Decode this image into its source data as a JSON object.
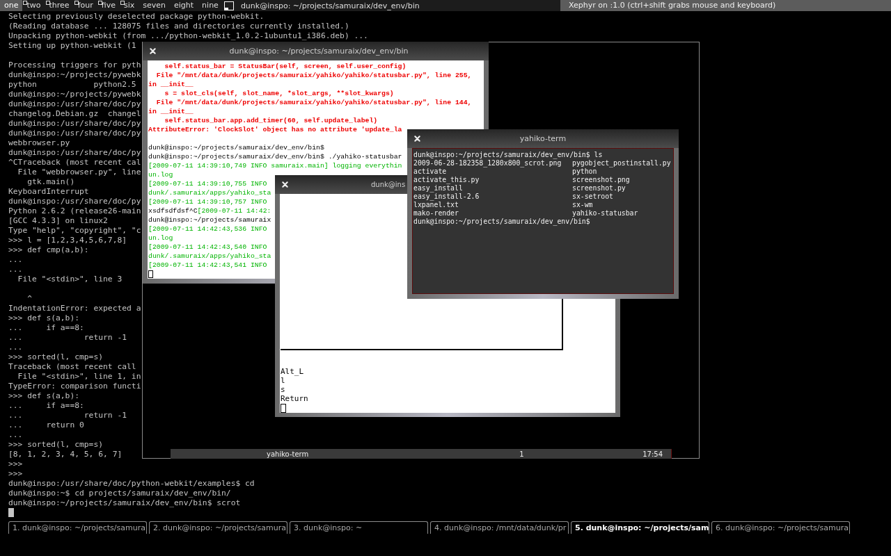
{
  "top_bar": {
    "workspaces": [
      {
        "label": "one",
        "selected": true,
        "occupied": false
      },
      {
        "label": "two",
        "selected": false,
        "occupied": true
      },
      {
        "label": "three",
        "selected": false,
        "occupied": true
      },
      {
        "label": "four",
        "selected": false,
        "occupied": true
      },
      {
        "label": "five",
        "selected": false,
        "occupied": true
      },
      {
        "label": "six",
        "selected": false,
        "occupied": true
      },
      {
        "label": "seven",
        "selected": false,
        "occupied": false
      },
      {
        "label": "eight",
        "selected": false,
        "occupied": false
      },
      {
        "label": "nine",
        "selected": false,
        "occupied": false
      }
    ],
    "window_title": "dunk@inspo: ~/projects/samuraix/dev_env/bin",
    "xephyr_title": "Xephyr on :1.0 (ctrl+shift grabs mouse and keyboard)"
  },
  "main_terminal": {
    "lines": [
      {
        "kind": "text",
        "text": "Selecting previously deselected package python-webkit."
      },
      {
        "kind": "text",
        "text": "(Reading database ... 128075 files and directories currently installed.)"
      },
      {
        "kind": "text",
        "text": "Unpacking python-webkit (from .../python-webkit_1.0.2-1ubuntu1_i386.deb) ..."
      },
      {
        "kind": "text",
        "text": "Setting up python-webkit (1"
      },
      {
        "kind": "blank"
      },
      {
        "kind": "text",
        "text": "Processing triggers for pyth"
      },
      {
        "kind": "text",
        "text": "dunk@inspo:~/projects/pywebk"
      },
      {
        "kind": "text",
        "text": "python            python2.5"
      },
      {
        "kind": "text",
        "text": "dunk@inspo:~/projects/pywebk"
      },
      {
        "kind": "text",
        "text": "dunk@inspo:/usr/share/doc/py"
      },
      {
        "kind": "text",
        "text": "changelog.Debian.gz  changel"
      },
      {
        "kind": "text",
        "text": "dunk@inspo:/usr/share/doc/py"
      },
      {
        "kind": "text",
        "text": "dunk@inspo:/usr/share/doc/py"
      },
      {
        "kind": "text",
        "text": "webbrowser.py"
      },
      {
        "kind": "text",
        "text": "dunk@inspo:/usr/share/doc/py"
      },
      {
        "kind": "text",
        "text": "^CTraceback (most recent cal"
      },
      {
        "kind": "text",
        "text": "  File \"webbrowser.py\", line"
      },
      {
        "kind": "text",
        "text": "    gtk.main()"
      },
      {
        "kind": "text",
        "text": "KeyboardInterrupt"
      },
      {
        "kind": "text",
        "text": "dunk@inspo:/usr/share/doc/py"
      },
      {
        "kind": "text",
        "text": "Python 2.6.2 (release26-main"
      },
      {
        "kind": "text",
        "text": "[GCC 4.3.3] on linux2"
      },
      {
        "kind": "text",
        "text": "Type \"help\", \"copyright\", \"c"
      },
      {
        "kind": "text",
        "text": ">>> l = [1,2,3,4,5,6,7,8]"
      },
      {
        "kind": "text",
        "text": ">>> def cmp(a,b):"
      },
      {
        "kind": "text",
        "text": "..."
      },
      {
        "kind": "text",
        "text": "..."
      },
      {
        "kind": "text",
        "text": "  File \"<stdin>\", line 3"
      },
      {
        "kind": "blank"
      },
      {
        "kind": "text",
        "text": "    ^"
      },
      {
        "kind": "text",
        "text": "IndentationError: expected a"
      },
      {
        "kind": "text",
        "text": ">>> def s(a,b):"
      },
      {
        "kind": "text",
        "text": "...     if a==8:"
      },
      {
        "kind": "text",
        "text": "...             return -1"
      },
      {
        "kind": "text",
        "text": "..."
      },
      {
        "kind": "text",
        "text": ">>> sorted(l, cmp=s)"
      },
      {
        "kind": "text",
        "text": "Traceback (most recent call"
      },
      {
        "kind": "text",
        "text": "  File \"<stdin>\", line 1, in"
      },
      {
        "kind": "text",
        "text": "TypeError: comparison functi"
      },
      {
        "kind": "text",
        "text": ">>> def s(a,b):"
      },
      {
        "kind": "text",
        "text": "...     if a==8:"
      },
      {
        "kind": "text",
        "text": "...             return -1"
      },
      {
        "kind": "text",
        "text": "...     return 0"
      },
      {
        "kind": "text",
        "text": "..."
      },
      {
        "kind": "text",
        "text": ">>> sorted(l, cmp=s)"
      },
      {
        "kind": "text",
        "text": "[8, 1, 2, 3, 4, 5, 6, 7]"
      },
      {
        "kind": "text",
        "text": ">>>"
      },
      {
        "kind": "text",
        "text": ">>>"
      },
      {
        "kind": "text",
        "text": "dunk@inspo:/usr/share/doc/python-webkit/examples$ cd"
      },
      {
        "kind": "text",
        "text": "dunk@inspo:~$ cd projects/samuraix/dev_env/bin/"
      },
      {
        "kind": "text",
        "text": "dunk@inspo:~/projects/samuraix/dev_env/bin$ scrot"
      },
      {
        "kind": "cursor"
      }
    ]
  },
  "error_terminal": {
    "title": "dunk@inspo: ~/projects/samuraix/dev_env/bin",
    "lines": [
      {
        "kind": "text",
        "segments": [
          {
            "kind": "error",
            "text": "    self.status_bar = StatusBar(self, screen, self.user_config)"
          }
        ]
      },
      {
        "kind": "text",
        "segments": [
          {
            "kind": "error",
            "text": "  File \"/mnt/data/dunk/projects/samuraix/yahiko/yahiko/statusbar.py\", line 255,"
          }
        ]
      },
      {
        "kind": "text",
        "segments": [
          {
            "kind": "error",
            "text": "in __init__"
          }
        ]
      },
      {
        "kind": "text",
        "segments": [
          {
            "kind": "error",
            "text": "    s = slot_cls(self, slot_name, *slot_args, **slot_kwargs)"
          }
        ]
      },
      {
        "kind": "text",
        "segments": [
          {
            "kind": "error",
            "text": "  File \"/mnt/data/dunk/projects/samuraix/yahiko/yahiko/statusbar.py\", line 144,"
          }
        ]
      },
      {
        "kind": "text",
        "segments": [
          {
            "kind": "error",
            "text": "in __init__"
          }
        ]
      },
      {
        "kind": "text",
        "segments": [
          {
            "kind": "error",
            "text": "    self.status_bar.app.add_timer(60, self.update_label)"
          }
        ]
      },
      {
        "kind": "text",
        "segments": [
          {
            "kind": "error",
            "text": "AttributeError: 'ClockSlot' object has no attribute 'update_la"
          }
        ]
      },
      {
        "kind": "blank"
      },
      {
        "kind": "text",
        "segments": [
          {
            "kind": "output",
            "text": "dunk@inspo:~/projects/samuraix/dev_env/bin$"
          }
        ]
      },
      {
        "kind": "text",
        "segments": [
          {
            "kind": "output",
            "text": "dunk@inspo:~/projects/samuraix/dev_env/bin$ ./yahiko-statusbar"
          }
        ]
      },
      {
        "kind": "text",
        "segments": [
          {
            "kind": "log",
            "text": "[2009-07-11 14:39:10,749 INFO samuraix.main] logging everythin"
          }
        ]
      },
      {
        "kind": "text",
        "segments": [
          {
            "kind": "log",
            "text": "un.log"
          }
        ]
      },
      {
        "kind": "text",
        "segments": [
          {
            "kind": "log",
            "text": "[2009-07-11 14:39:10,755 INFO"
          }
        ]
      },
      {
        "kind": "text",
        "segments": [
          {
            "kind": "log",
            "text": "dunk/.samuraix/apps/yahiko_sta"
          }
        ]
      },
      {
        "kind": "text",
        "segments": [
          {
            "kind": "log",
            "text": "[2009-07-11 14:39:10,757 INFO"
          }
        ]
      },
      {
        "kind": "text",
        "segments": [
          {
            "kind": "output",
            "text": "xsdfsdfdsf^C"
          },
          {
            "kind": "log",
            "text": "[2009-07-11 14:42:"
          }
        ]
      },
      {
        "kind": "text",
        "segments": [
          {
            "kind": "output",
            "text": "dunk@inspo:~/projects/samuraix"
          }
        ]
      },
      {
        "kind": "text",
        "segments": [
          {
            "kind": "log",
            "text": "[2009-07-11 14:42:43,536 INFO"
          }
        ]
      },
      {
        "kind": "text",
        "segments": [
          {
            "kind": "log",
            "text": "un.log"
          }
        ]
      },
      {
        "kind": "text",
        "segments": [
          {
            "kind": "log",
            "text": "[2009-07-11 14:42:43,540 INFO"
          }
        ]
      },
      {
        "kind": "text",
        "segments": [
          {
            "kind": "log",
            "text": "dunk/.samuraix/apps/yahiko_sta"
          }
        ]
      },
      {
        "kind": "text",
        "segments": [
          {
            "kind": "log",
            "text": "[2009-07-11 14:42:43,541 INFO"
          }
        ]
      },
      {
        "kind": "cursor"
      }
    ]
  },
  "key_window": {
    "title": "dunk@ins",
    "lines": [
      {
        "kind": "text",
        "text": "Alt_L"
      },
      {
        "kind": "text",
        "text": "l"
      },
      {
        "kind": "text",
        "text": "s"
      },
      {
        "kind": "text",
        "text": "Return"
      },
      {
        "kind": "cursor"
      }
    ]
  },
  "yahiko_term": {
    "title": "yahiko-term",
    "command_line": "dunk@inspo:~/projects/samuraix/dev_env/bin$ ls",
    "listing": [
      [
        "2009-06-28-182358_1280x800_scrot.png",
        "pygobject_postinstall.py"
      ],
      [
        "activate",
        "python"
      ],
      [
        "activate_this.py",
        "screenshot.png"
      ],
      [
        "easy_install",
        "screenshot.py"
      ],
      [
        "easy_install-2.6",
        "sx-setroot"
      ],
      [
        "lxpanel.txt",
        "sx-wm"
      ],
      [
        "mako-render",
        "yahiko-statusbar"
      ]
    ],
    "prompt": "dunk@inspo:~/projects/samuraix/dev_env/bin$"
  },
  "status_bar": {
    "window_title": "yahiko-term",
    "workspace": "1",
    "clock": "17:54"
  },
  "taskbar": [
    {
      "label": "1. dunk@inspo: ~/projects/samura",
      "selected": false
    },
    {
      "label": "2. dunk@inspo: ~/projects/samura",
      "selected": false
    },
    {
      "label": "3. dunk@inspo: ~",
      "selected": false
    },
    {
      "label": "4. dunk@inspo: /mnt/data/dunk/pr",
      "selected": false
    },
    {
      "label": "5. dunk@inspo: ~/projects/sam",
      "selected": true
    },
    {
      "label": "6. dunk@inspo: ~/projects/samura",
      "selected": false
    }
  ]
}
